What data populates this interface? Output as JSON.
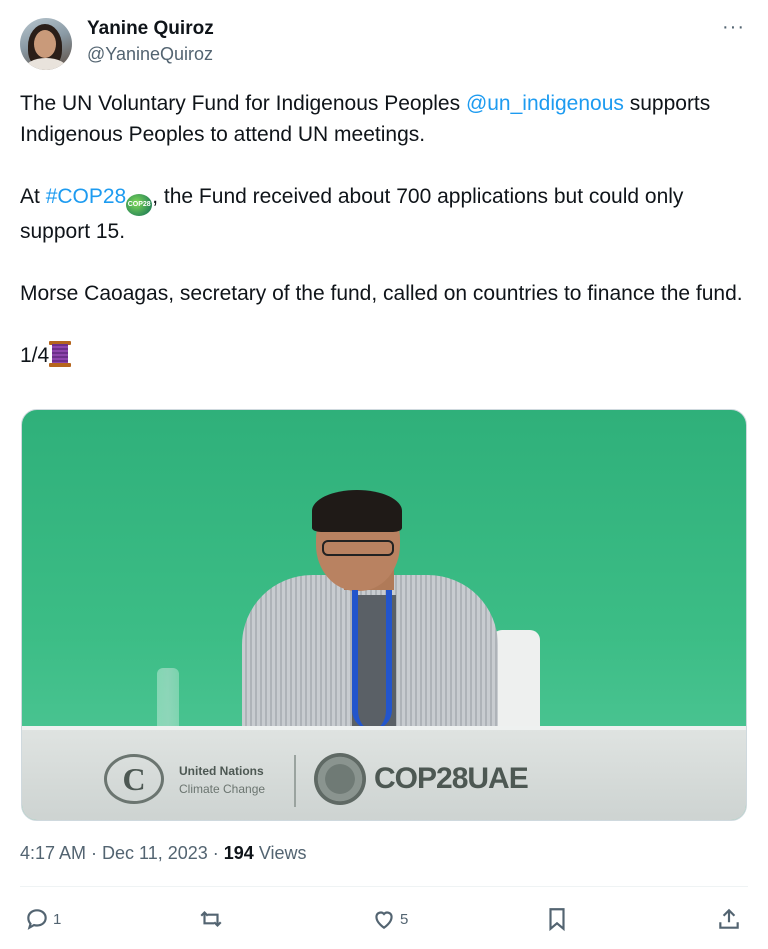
{
  "author": {
    "name": "Yanine Quiroz",
    "handle": "@YanineQuiroz"
  },
  "more_label": "···",
  "tweet": {
    "p1_text": "The UN Voluntary Fund for Indigenous Peoples ",
    "p1_mention": "@un_indigenous",
    "p1_rest": " supports Indigenous Peoples to attend UN meetings.",
    "p2_prefix": "At ",
    "p2_hashtag": "#COP28",
    "p2_rest": ", the Fund received about 700 applications but could only support 15.",
    "p3_text": "Morse Caoagas, secretary of the fund, called on countries to finance the fund.",
    "p4_text": "1/4",
    "globe_emoji_label": "COP28",
    "thread_emoji": "thread-emoji"
  },
  "media": {
    "un_line1": "United Nations",
    "un_line2": "Climate Change",
    "un_logo_glyph": "C",
    "cop_logo_text": "COP28UAE"
  },
  "meta": {
    "time_date": "4:17 AM · Dec 11, 2023 · ",
    "views_count": "194",
    "views_label": " Views"
  },
  "actions": {
    "reply_count": "1",
    "retweet_count": "",
    "like_count": "5"
  },
  "colors": {
    "link": "#1d9bf0",
    "secondary_text": "#536471",
    "primary_text": "#0f1419"
  },
  "icons": [
    "more-icon",
    "reply-icon",
    "retweet-icon",
    "like-icon",
    "bookmark-icon",
    "share-icon",
    "globe-emoji-icon",
    "thread-emoji-icon"
  ]
}
